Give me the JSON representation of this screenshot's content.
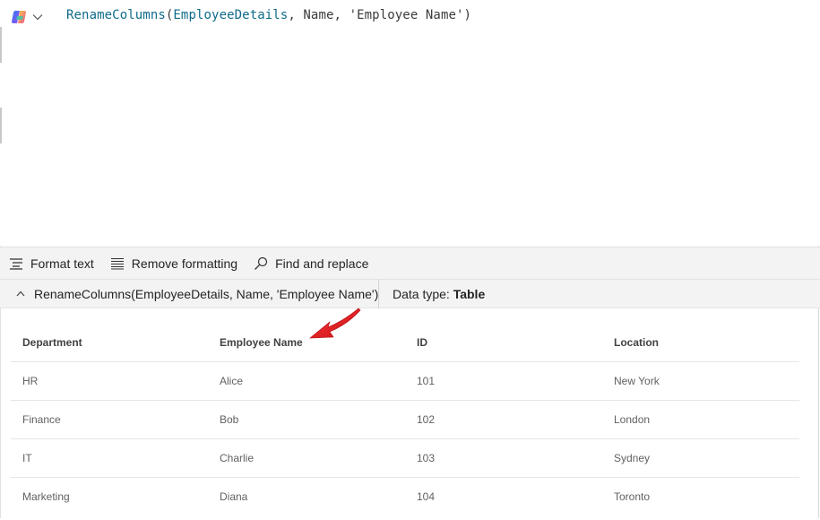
{
  "formula_bar": {
    "copilot_icon": "copilot-icon",
    "dropdown_icon": "chevron-down-icon",
    "formula": {
      "fn": "RenameColumns",
      "open": "(",
      "arg1": "EmployeeDetails",
      "sep1": ", ",
      "arg2": "Name",
      "sep2": ", ",
      "arg3": "'Employee Name'",
      "close": ")"
    }
  },
  "toolbar": {
    "format_text": "Format text",
    "remove_formatting": "Remove formatting",
    "find_replace": "Find and replace"
  },
  "result_bar": {
    "collapse_icon": "chevron-up-icon",
    "formula": "RenameColumns(EmployeeDetails, Name, 'Employee Name')",
    "datatype_label": "Data type: ",
    "datatype_value": "Table"
  },
  "table": {
    "columns": [
      "Department",
      "Employee Name",
      "ID",
      "Location"
    ],
    "rows": [
      [
        "HR",
        "Alice",
        "101",
        "New York"
      ],
      [
        "Finance",
        "Bob",
        "102",
        "London"
      ],
      [
        "IT",
        "Charlie",
        "103",
        "Sydney"
      ],
      [
        "Marketing",
        "Diana",
        "104",
        "Toronto"
      ]
    ]
  },
  "annotation": {
    "arrow_color": "#e8141b"
  }
}
